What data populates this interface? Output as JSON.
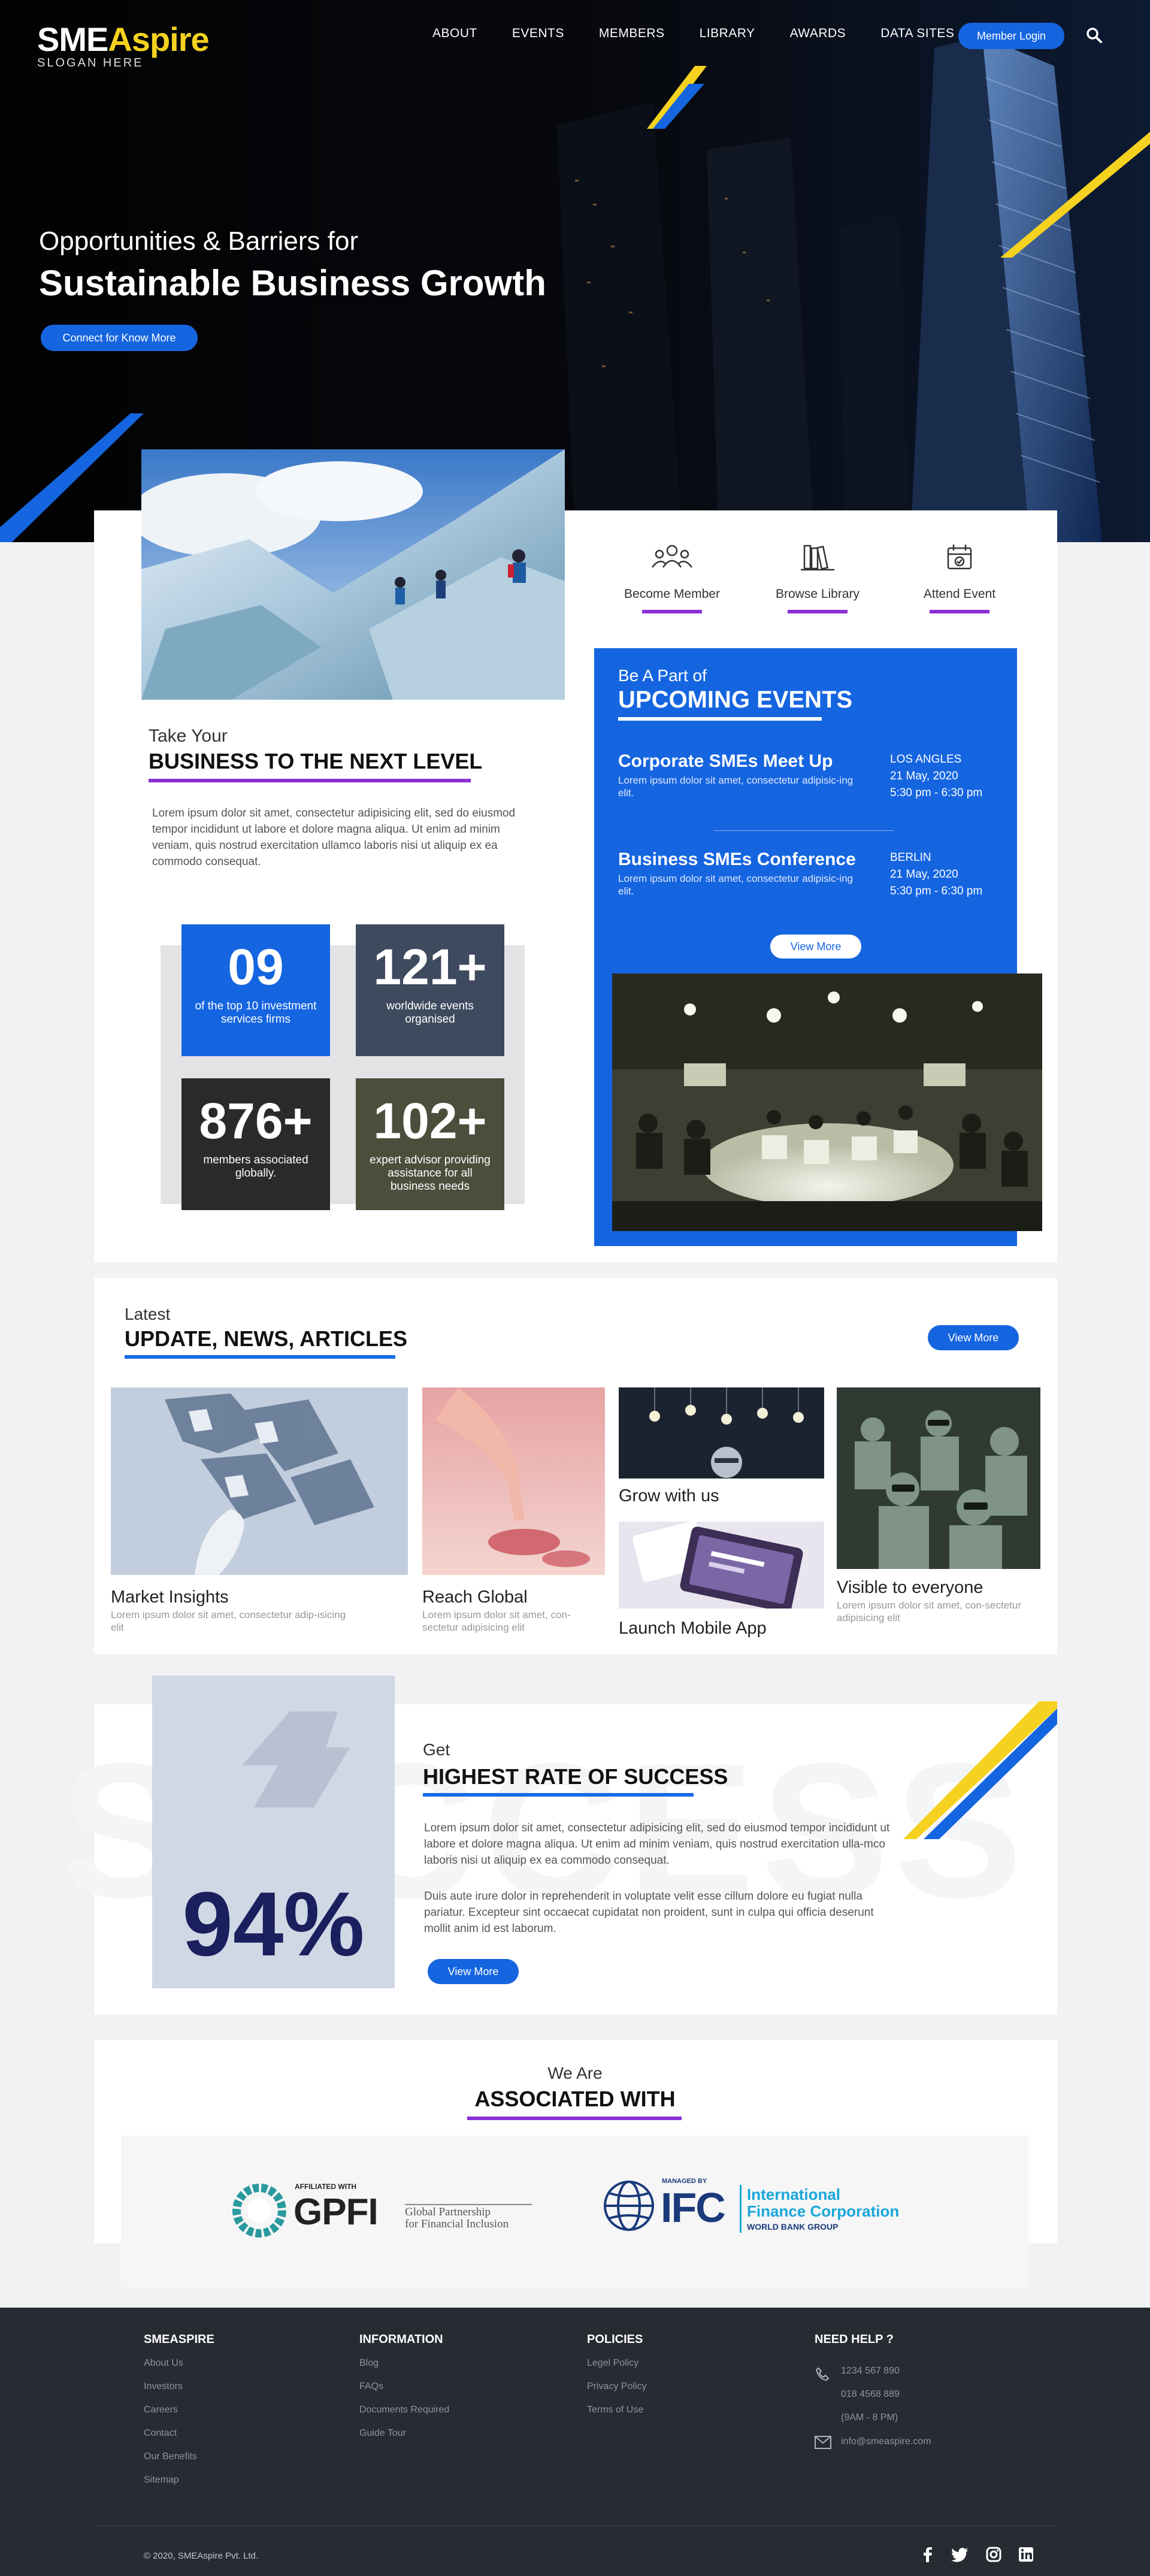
{
  "header": {
    "logo_main_a": "SME",
    "logo_main_b": "Aspire",
    "logo_sub": "SLOGAN HERE",
    "nav": [
      "ABOUT",
      "EVENTS",
      "MEMBERS",
      "LIBRARY",
      "AWARDS",
      "DATA SITES"
    ],
    "login_label": "Member Login",
    "search_icon": "search-icon"
  },
  "hero": {
    "subtitle": "Opportunities & Barriers for",
    "title": "Sustainable Business Growth",
    "button": "Connect for Know More"
  },
  "intro": {
    "eyebrow": "Take Your",
    "heading": "BUSINESS TO THE NEXT LEVEL",
    "body": "Lorem ipsum dolor sit amet, consectetur adipisicing elit, sed do eiusmod tempor incididunt ut labore et dolore magna aliqua. Ut enim ad minim veniam, quis nostrud exercitation ullamco laboris nisi ut aliquip ex ea commodo consequat."
  },
  "stats": [
    {
      "number": "09",
      "label": "of the top 10 investment services firms",
      "color": "#1565e0"
    },
    {
      "number": "121+",
      "label": "worldwide events organised",
      "color": "#3e4a5e"
    },
    {
      "number": "876+",
      "label": "members associated globally.",
      "color": "#2a2a2c"
    },
    {
      "number": "102+",
      "label": "expert advisor providing assistance for all business needs",
      "color": "#4a4f3c"
    }
  ],
  "quick_links": [
    {
      "label": "Become Member",
      "icon": "members-icon"
    },
    {
      "label": "Browse Library",
      "icon": "library-icon"
    },
    {
      "label": "Attend Event",
      "icon": "calendar-icon"
    }
  ],
  "events": {
    "eyebrow": "Be A Part of",
    "heading": "UPCOMING EVENTS",
    "items": [
      {
        "title": "Corporate SMEs Meet Up",
        "desc": "Lorem ipsum dolor sit amet, consectetur adipisic-ing elit.",
        "city": "LOS ANGLES",
        "date": "21 May, 2020",
        "time": "5:30 pm - 6:30 pm"
      },
      {
        "title": "Business SMEs Conference",
        "desc": "Lorem ipsum dolor sit amet, consectetur adipisic-ing elit.",
        "city": "BERLIN",
        "date": "21 May, 2020",
        "time": "5:30 pm - 6:30 pm"
      }
    ],
    "button": "View More"
  },
  "news": {
    "eyebrow": "Latest",
    "heading": "UPDATE, NEWS, ARTICLES",
    "button": "View More",
    "cards": [
      {
        "title": "Market Insights",
        "desc": "Lorem ipsum dolor sit amet, consectetur adip-isicing elit"
      },
      {
        "title": "Reach Global",
        "desc": "Lorem ipsum dolor sit amet, con-sectetur adipisicing elit"
      },
      {
        "title": "Grow with us",
        "desc": ""
      },
      {
        "title": "Launch Mobile App",
        "desc": ""
      },
      {
        "title": "Visible to everyone",
        "desc": "Lorem ipsum dolor sit amet, con-sectetur adipisicing elit"
      }
    ]
  },
  "success": {
    "watermark": "SUCCESS",
    "percent": "94%",
    "eyebrow": "Get",
    "heading": "HIGHEST RATE OF SUCCESS",
    "para1": "Lorem ipsum dolor sit amet, consectetur adipisicing elit, sed do eiusmod tempor incididunt ut labore et dolore magna aliqua. Ut enim ad minim veniam, quis nostrud exercitation ulla-mco laboris nisi ut aliquip ex ea commodo consequat.",
    "para2": "Duis aute irure dolor in reprehenderit in voluptate velit esse cillum dolore eu fugiat nulla pariatur. Excepteur sint occaecat cupidatat non proident, sunt in culpa qui officia deserunt mollit anim id est laborum.",
    "button": "View More"
  },
  "associated": {
    "eyebrow": "We Are",
    "heading": "ASSOCIATED WITH",
    "gpfi_top": "AFFILIATED WITH",
    "gpfi_name": "GPFI",
    "gpfi_tag1": "Global Partnership",
    "gpfi_tag2": "for Financial Inclusion",
    "ifc_top": "MANAGED BY",
    "ifc_name": "IFC",
    "ifc_tag1": "International",
    "ifc_tag2": "Finance Corporation",
    "ifc_tag3": "WORLD BANK GROUP"
  },
  "footer": {
    "columns": [
      {
        "heading": "SMEASPIRE",
        "links": [
          "About Us",
          "Investors",
          "Careers",
          "Contact",
          "Our Benefits",
          "Sitemap"
        ]
      },
      {
        "heading": "INFORMATION",
        "links": [
          "Blog",
          "FAQs",
          "Documents Required",
          "Guide Tour"
        ]
      },
      {
        "heading": "POLICIES",
        "links": [
          "Legel Policy",
          "Privacy Policy",
          "Terms of Use"
        ]
      }
    ],
    "help_heading": "NEED HELP ?",
    "phone1": "1234 567 890",
    "phone2": "018 4568 889",
    "hours": "(9AM - 8 PM)",
    "email": "info@smeaspire.com",
    "copyright": "© 2020, SMEAspire Pvt. Ltd.",
    "social": [
      "facebook-icon",
      "twitter-icon",
      "instagram-icon",
      "linkedin-icon"
    ]
  },
  "colors": {
    "accent": "#1565e0",
    "yellow": "#f5d21f",
    "purple": "#8b2fd6",
    "footer": "#272b32"
  }
}
